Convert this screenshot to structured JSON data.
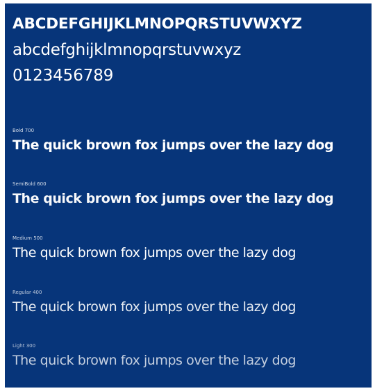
{
  "specimen": {
    "background": "#07357a",
    "text_color": "#ffffff",
    "uppercase": "ABCDEFGHIJKLMNOPQRSTUVWXYZ",
    "lowercase": "abcdefghijklmnopqrstuvwxyz",
    "digits": "0123456789",
    "pangram": "The quick brown fox jumps over the lazy dog",
    "weights": [
      {
        "label": "Bold 700",
        "text": "The quick brown fox jumps over the lazy dog"
      },
      {
        "label": "SemiBold 600",
        "text": "The quick brown fox jumps over the lazy dog"
      },
      {
        "label": "Medium 500",
        "text": "The quick brown fox jumps over the lazy dog"
      },
      {
        "label": "Regular 400",
        "text": "The quick brown fox jumps over the lazy dog"
      },
      {
        "label": "Light 300",
        "text": "The quick brown fox jumps over the lazy dog"
      }
    ]
  }
}
